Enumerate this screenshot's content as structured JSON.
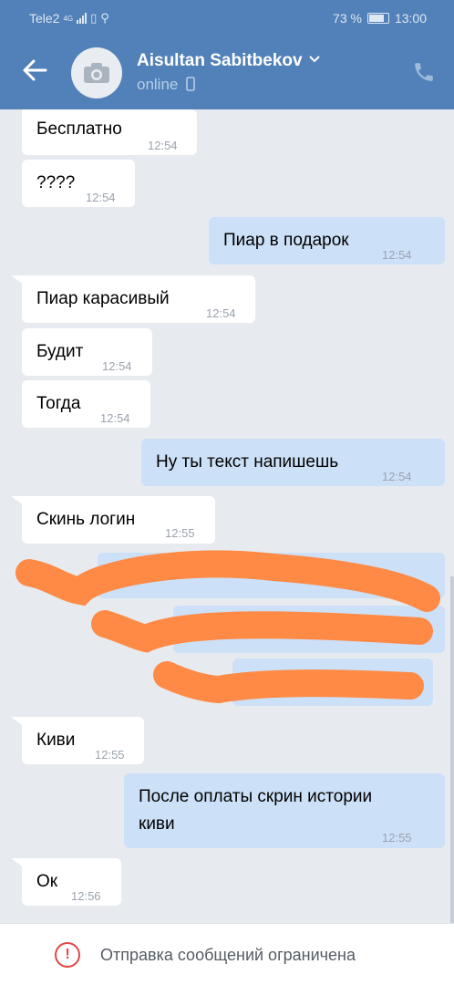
{
  "status_bar": {
    "carrier": "Tele2",
    "network": "4G",
    "battery": "73 %",
    "time": "13:00"
  },
  "header": {
    "contact_name": "Aisultan Sabitbekov",
    "contact_status": "online"
  },
  "messages": [
    {
      "text": "Бесплатно",
      "time": "12:54",
      "direction": "in"
    },
    {
      "text": "????",
      "time": "12:54",
      "direction": "in"
    },
    {
      "text": "Пиар в подарок",
      "time": "12:54",
      "direction": "out"
    },
    {
      "text": "Пиар карасивый",
      "time": "12:54",
      "direction": "in"
    },
    {
      "text": "Будит",
      "time": "12:54",
      "direction": "in"
    },
    {
      "text": "Тогда",
      "time": "12:54",
      "direction": "in"
    },
    {
      "text": "Ну ты текст напишешь",
      "time": "12:54",
      "direction": "out"
    },
    {
      "text": "Скинь логин",
      "time": "12:55",
      "direction": "in"
    },
    {
      "text": "Киви",
      "time": "12:55",
      "direction": "in"
    },
    {
      "text_line1": "После оплаты скрин истории",
      "text_line2": "киви",
      "time": "12:55",
      "direction": "out"
    },
    {
      "text": "Ок",
      "time": "12:56",
      "direction": "in"
    }
  ],
  "footer": {
    "notice": "Отправка сообщений ограничена"
  },
  "colors": {
    "header_bg": "#5181b8",
    "chat_bg": "#e7ebf0",
    "incoming_bubble": "#ffffff",
    "outgoing_bubble": "#cce0f8",
    "redaction": "#ff8a45",
    "warning": "#e64646"
  }
}
